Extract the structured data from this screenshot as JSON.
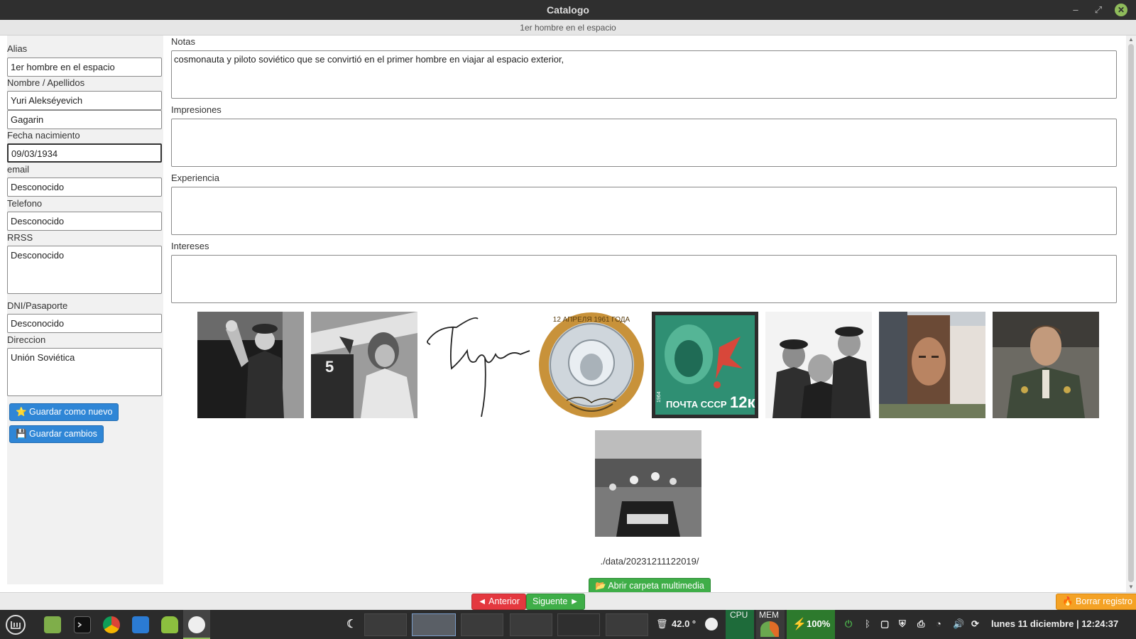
{
  "window": {
    "title": "Catalogo",
    "subtitle": "1er hombre en el espacio",
    "minimize_glyph": "–",
    "maximize_glyph": "⤢",
    "close_glyph": "✕"
  },
  "form": {
    "alias_label": "Alias",
    "alias_value": "1er hombre en el espacio",
    "nombre_label": "Nombre / Apellidos",
    "nombre_value": "Yuri Alekséyevich",
    "apellidos_value": "Gagarin",
    "fecha_label": "Fecha nacimiento",
    "fecha_value": "09/03/1934",
    "email_label": "email",
    "email_value": "Desconocido",
    "telefono_label": "Telefono",
    "telefono_value": "Desconocido",
    "rrss_label": "RRSS",
    "rrss_value": "Desconocido",
    "dni_label": "DNI/Pasaporte",
    "dni_value": "Desconocido",
    "direccion_label": "Direccion",
    "direccion_value": "Unión Soviética",
    "save_new_label": "⭐ Guardar como nuevo",
    "save_changes_label": "💾 Guardar cambios"
  },
  "details": {
    "notas_label": "Notas",
    "notas_value": "cosmonauta y piloto soviético que se convirtió en el primer hombre en viajar al espacio exterior,",
    "impresiones_label": "Impresiones",
    "impresiones_value": "",
    "experiencia_label": "Experiencia",
    "experiencia_value": "",
    "intereses_label": "Intereses",
    "intereses_value": ""
  },
  "media": {
    "folder_path": "./data/20231211122019/",
    "open_folder_label": "📂 Abrir carpeta multimedia",
    "coin_text_top": "12 АПРЕЛЯ 1961 ГОДА",
    "stamp_text_bottom": "ПОЧТА СССР",
    "stamp_value": "12к",
    "stamp_year": "1964"
  },
  "navigation": {
    "prev_label": "◄ Anterior",
    "next_label": "Siguente ►",
    "delete_label": "🔥 Borrar registro"
  },
  "taskbar": {
    "temperature": "42.0 °",
    "cpu_label": "CPU",
    "mem_label": "MEM",
    "battery": "100%",
    "datetime": "lunes 11 diciembre | 12:24:37"
  }
}
